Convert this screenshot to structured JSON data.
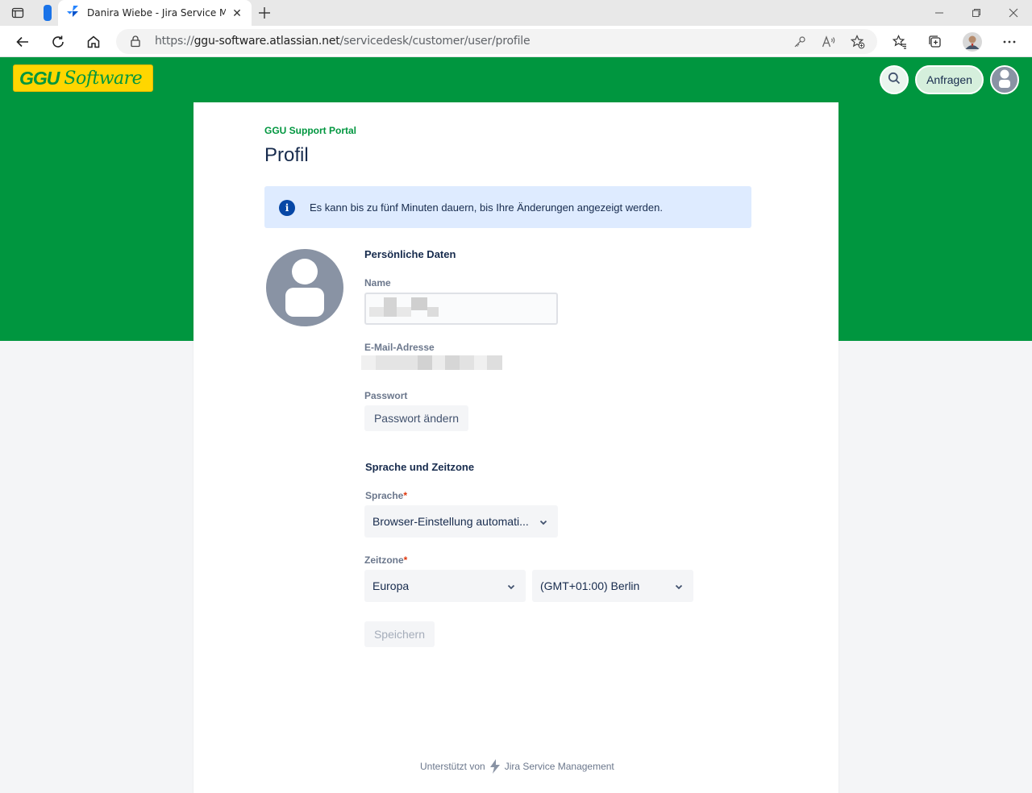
{
  "browser": {
    "tab_title": "Danira Wiebe - Jira Service Management",
    "url_scheme": "https://",
    "url_host": "ggu-software.atlassian.net",
    "url_path": "/servicedesk/customer/user/profile"
  },
  "header": {
    "logo_ggu": "GGU",
    "logo_software": "Software",
    "requests_label": "Anfragen"
  },
  "page": {
    "portal_link": "GGU Support Portal",
    "title": "Profil",
    "info_message": "Es kann bis zu fünf Minuten dauern, bis Ihre Änderungen angezeigt werden."
  },
  "personal": {
    "section_title": "Persönliche Daten",
    "name_label": "Name",
    "email_label": "E-Mail-Adresse",
    "password_label": "Passwort",
    "change_password_label": "Passwort ändern"
  },
  "locale": {
    "section_title": "Sprache und Zeitzone",
    "language_label": "Sprache",
    "language_value": "Browser-Einstellung automati...",
    "timezone_label": "Zeitzone",
    "region_value": "Europa",
    "city_value": "(GMT+01:00) Berlin",
    "required_marker": "*"
  },
  "actions": {
    "save_label": "Speichern"
  },
  "footer": {
    "prefix": "Unterstützt von",
    "product": "Jira Service Management"
  },
  "colors": {
    "brand_green": "#00963f",
    "logo_yellow": "#ffd600",
    "info_bg": "#deebff"
  }
}
